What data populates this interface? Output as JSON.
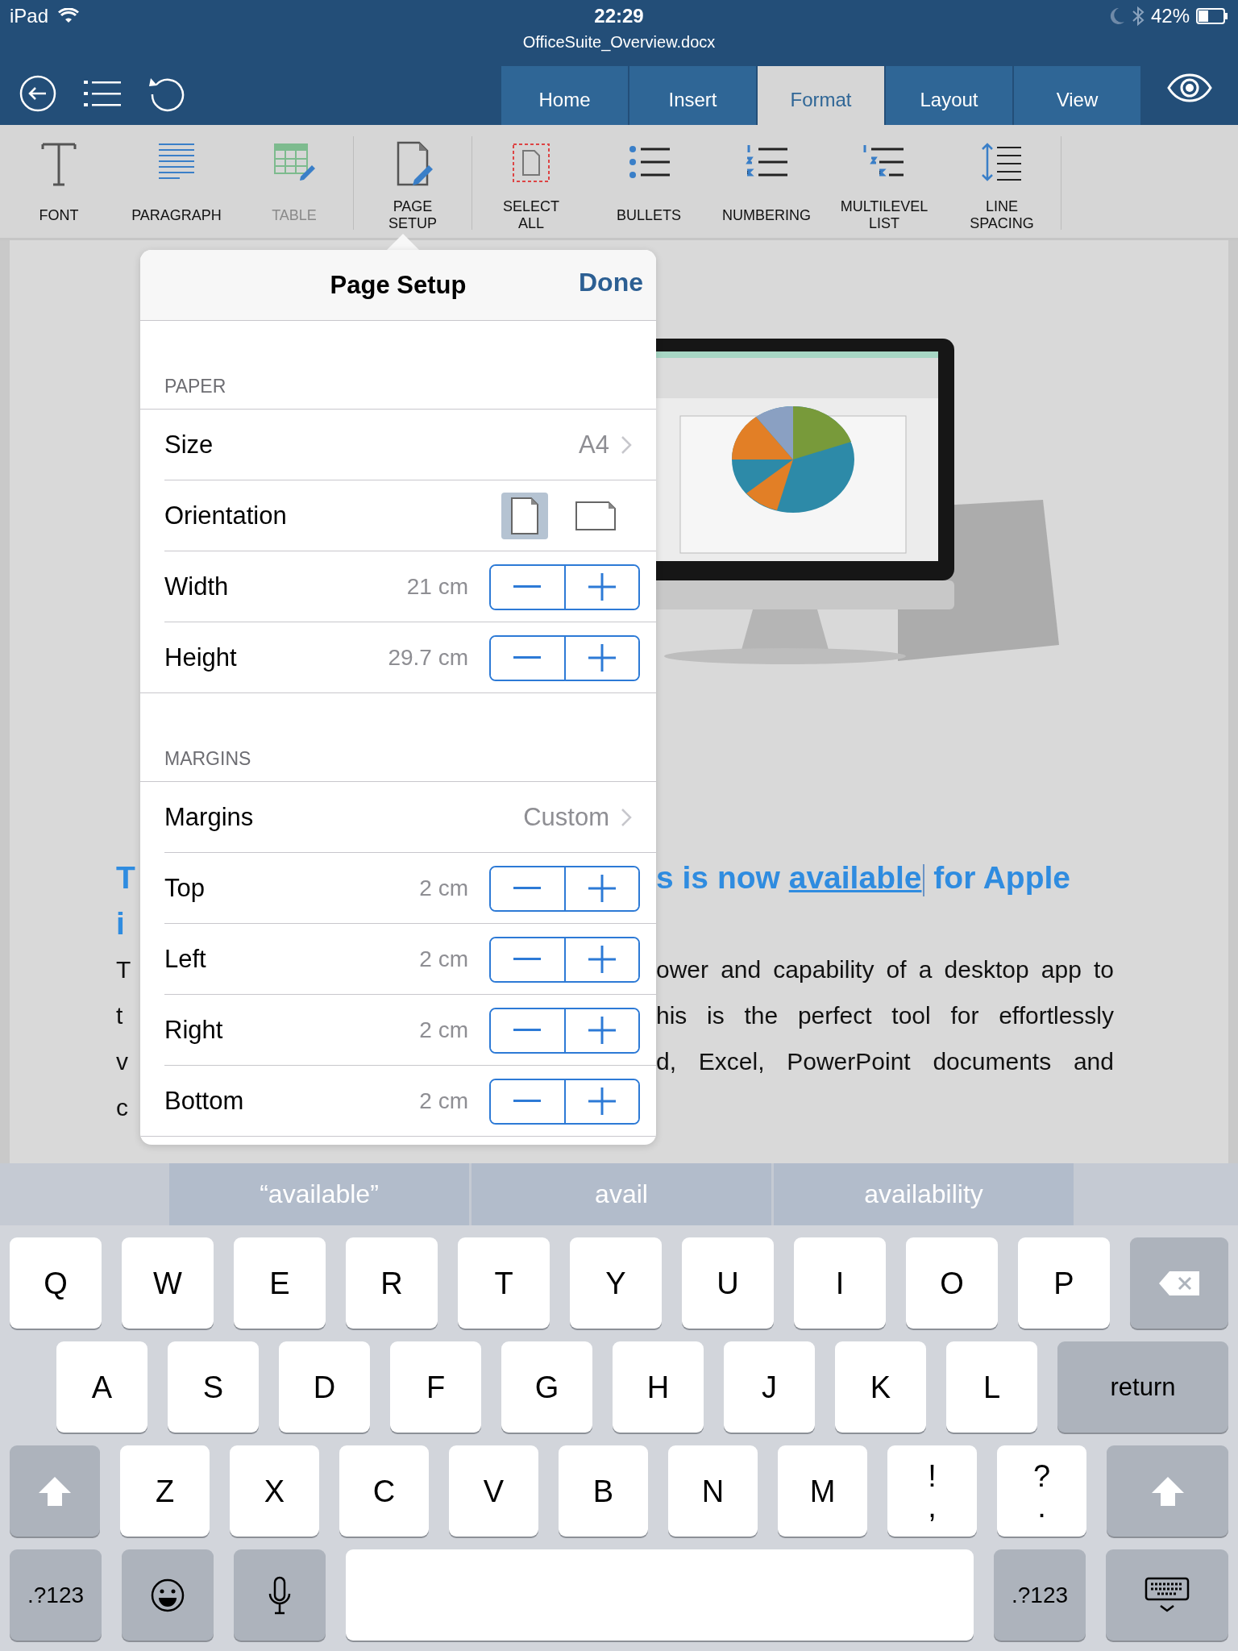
{
  "status_bar": {
    "carrier": "iPad",
    "time": "22:29",
    "battery": "42%"
  },
  "document_title": "OfficeSuite_Overview.docx",
  "tabs": [
    {
      "label": "Home",
      "selected": false
    },
    {
      "label": "Insert",
      "selected": false
    },
    {
      "label": "Format",
      "selected": true
    },
    {
      "label": "Layout",
      "selected": false
    },
    {
      "label": "View",
      "selected": false
    }
  ],
  "toolbar": [
    {
      "kind": "font",
      "label": "FONT",
      "disabled": false
    },
    {
      "kind": "paragraph",
      "label": "PARAGRAPH",
      "disabled": false
    },
    {
      "kind": "table",
      "label": "TABLE",
      "disabled": true
    },
    {
      "kind": "divider"
    },
    {
      "kind": "page_setup",
      "label": "PAGE\nSETUP",
      "disabled": false
    },
    {
      "kind": "divider"
    },
    {
      "kind": "select_all",
      "label": "SELECT\nALL",
      "disabled": false
    },
    {
      "kind": "bullets",
      "label": "BULLETS",
      "disabled": false
    },
    {
      "kind": "numbering",
      "label": "NUMBERING",
      "disabled": false
    },
    {
      "kind": "multilevel",
      "label": "MULTILEVEL\nLIST",
      "disabled": false
    },
    {
      "kind": "line_spacing",
      "label": "LINE\nSPACING",
      "disabled": false
    },
    {
      "kind": "divider"
    }
  ],
  "document": {
    "lines": [
      {
        "kind": "heading",
        "left": "T",
        "right": [
          {
            "text": "s is now ",
            "underlined": false,
            "cursor": false
          },
          {
            "text": "available",
            "underlined": true,
            "cursor": true
          },
          {
            "text": " for Apple",
            "underlined": false,
            "cursor": false
          }
        ]
      },
      {
        "kind": "heading",
        "left": "i"
      },
      {
        "kind": "body",
        "left": "T",
        "right_text": "ower and capability of a desktop app to"
      },
      {
        "kind": "body",
        "left": "t",
        "right_text": "his is the perfect tool for effortlessly"
      },
      {
        "kind": "body",
        "left": "v",
        "right_text": "d, Excel, PowerPoint documents and"
      },
      {
        "kind": "body",
        "left": "c"
      }
    ]
  },
  "popover": {
    "title": "Page Setup",
    "done": "Done",
    "sections": [
      {
        "header": "PAPER",
        "rows": [
          {
            "kind": "disclosure",
            "label": "Size",
            "value": "A4"
          },
          {
            "kind": "orientation",
            "label": "Orientation",
            "options": [
              {
                "kind": "portrait",
                "selected": true
              },
              {
                "kind": "landscape",
                "selected": false
              }
            ]
          },
          {
            "kind": "stepper",
            "label": "Width",
            "value": "21 cm"
          },
          {
            "kind": "stepper",
            "label": "Height",
            "value": "29.7 cm"
          }
        ]
      },
      {
        "header": "MARGINS",
        "rows": [
          {
            "kind": "disclosure",
            "label": "Margins",
            "value": "Custom"
          },
          {
            "kind": "stepper",
            "label": "Top",
            "value": "2 cm"
          },
          {
            "kind": "stepper",
            "label": "Left",
            "value": "2 cm"
          },
          {
            "kind": "stepper",
            "label": "Right",
            "value": "2 cm"
          },
          {
            "kind": "stepper",
            "label": "Bottom",
            "value": "2 cm"
          }
        ]
      }
    ]
  },
  "suggestions": [
    "“available”",
    "avail",
    "availability"
  ],
  "keyboard": [
    [
      {
        "kind": "letter",
        "label": "Q"
      },
      {
        "kind": "letter",
        "label": "W"
      },
      {
        "kind": "letter",
        "label": "E"
      },
      {
        "kind": "letter",
        "label": "R"
      },
      {
        "kind": "letter",
        "label": "T"
      },
      {
        "kind": "letter",
        "label": "Y"
      },
      {
        "kind": "letter",
        "label": "U"
      },
      {
        "kind": "letter",
        "label": "I"
      },
      {
        "kind": "letter",
        "label": "O"
      },
      {
        "kind": "letter",
        "label": "P"
      },
      {
        "kind": "backspace"
      }
    ],
    [
      {
        "kind": "letter",
        "label": "A"
      },
      {
        "kind": "letter",
        "label": "S"
      },
      {
        "kind": "letter",
        "label": "D"
      },
      {
        "kind": "letter",
        "label": "F"
      },
      {
        "kind": "letter",
        "label": "G"
      },
      {
        "kind": "letter",
        "label": "H"
      },
      {
        "kind": "letter",
        "label": "J"
      },
      {
        "kind": "letter",
        "label": "K"
      },
      {
        "kind": "letter",
        "label": "L"
      },
      {
        "kind": "return",
        "label": "return"
      }
    ],
    [
      {
        "kind": "shift"
      },
      {
        "kind": "letter",
        "label": "Z"
      },
      {
        "kind": "letter",
        "label": "X"
      },
      {
        "kind": "letter",
        "label": "C"
      },
      {
        "kind": "letter",
        "label": "V"
      },
      {
        "kind": "letter",
        "label": "B"
      },
      {
        "kind": "letter",
        "label": "N"
      },
      {
        "kind": "letter",
        "label": "M"
      },
      {
        "kind": "punct",
        "label": "!\n,"
      },
      {
        "kind": "punct",
        "label": "?\n."
      },
      {
        "kind": "shift"
      }
    ],
    [
      {
        "kind": "mode",
        "label": ".?123"
      },
      {
        "kind": "emoji"
      },
      {
        "kind": "mic"
      },
      {
        "kind": "space"
      },
      {
        "kind": "mode",
        "label": ".?123"
      },
      {
        "kind": "hide"
      }
    ]
  ]
}
